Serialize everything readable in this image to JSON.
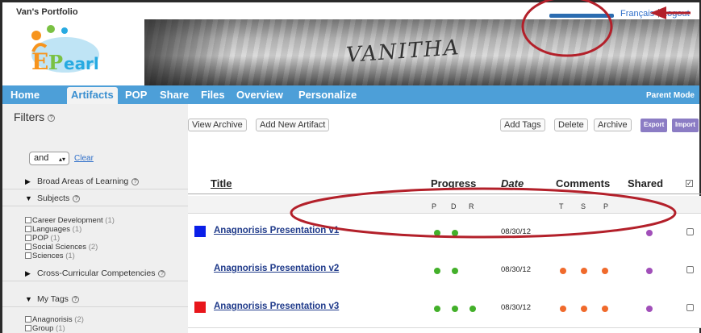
{
  "top": {
    "portfolio_title": "Van's Portfolio",
    "lang_link": "Français",
    "lang_sep": "|",
    "logout_link": "Logout"
  },
  "banner": {
    "text": "VANITHA"
  },
  "nav": {
    "items": [
      "Home",
      "Artifacts",
      "POP",
      "Share",
      "Files",
      "Overview",
      "Personalize"
    ],
    "active": "Artifacts",
    "parent_mode": "Parent Mode"
  },
  "sidebar": {
    "filters_label": "Filters",
    "and_select": "and",
    "clear_link": "Clear",
    "broad_areas": "Broad Areas of Learning",
    "subjects": "Subjects",
    "subject_items": [
      {
        "label": "Career Development",
        "count": "(1)"
      },
      {
        "label": "Languages",
        "count": "(1)"
      },
      {
        "label": "POP",
        "count": "(1)"
      },
      {
        "label": "Social Sciences",
        "count": "(2)"
      },
      {
        "label": "Sciences",
        "count": "(1)"
      }
    ],
    "cross_curricular": "Cross-Curricular Competencies",
    "my_tags": "My Tags",
    "tag_items": [
      {
        "label": "Anagnorisis",
        "count": "(2)"
      },
      {
        "label": "Group",
        "count": "(1)"
      }
    ]
  },
  "toolbar": {
    "view_archive": "View Archive",
    "add_new_artifact": "Add New Artifact",
    "add_tags": "Add Tags",
    "delete": "Delete",
    "archive": "Archive",
    "export": "Export",
    "import": "Import"
  },
  "table": {
    "headers": {
      "title": "Title",
      "progress": "Progress",
      "date": "Date",
      "comments": "Comments",
      "shared": "Shared"
    },
    "progress_sub": [
      "P",
      "D",
      "R"
    ],
    "comments_sub": [
      "T",
      "S",
      "P"
    ],
    "rows": [
      {
        "title": "Anagnorisis Presentation v1",
        "swatch": "#0a1fe8",
        "progress": [
          "#43b02a",
          "#43b02a"
        ],
        "date": "08/30/12",
        "comments": [],
        "shared": "#a14fb9"
      },
      {
        "title": "Anagnorisis Presentation v2",
        "swatch": "",
        "progress": [
          "#43b02a",
          "#43b02a"
        ],
        "date": "08/30/12",
        "comments": [
          "#f06a2c",
          "#f06a2c",
          "#f06a2c"
        ],
        "shared": "#a14fb9"
      },
      {
        "title": "Anagnorisis Presentation v3",
        "swatch": "#e8161b",
        "progress": [
          "#43b02a",
          "#43b02a",
          "#43b02a"
        ],
        "date": "08/30/12",
        "comments": [
          "#f06a2c",
          "#f06a2c",
          "#f06a2c"
        ],
        "shared": "#a14fb9"
      }
    ]
  },
  "colors": {
    "nav_blue": "#4d9fd8",
    "annotation_red": "#b3202a",
    "export_purple": "#8b7cc4"
  }
}
